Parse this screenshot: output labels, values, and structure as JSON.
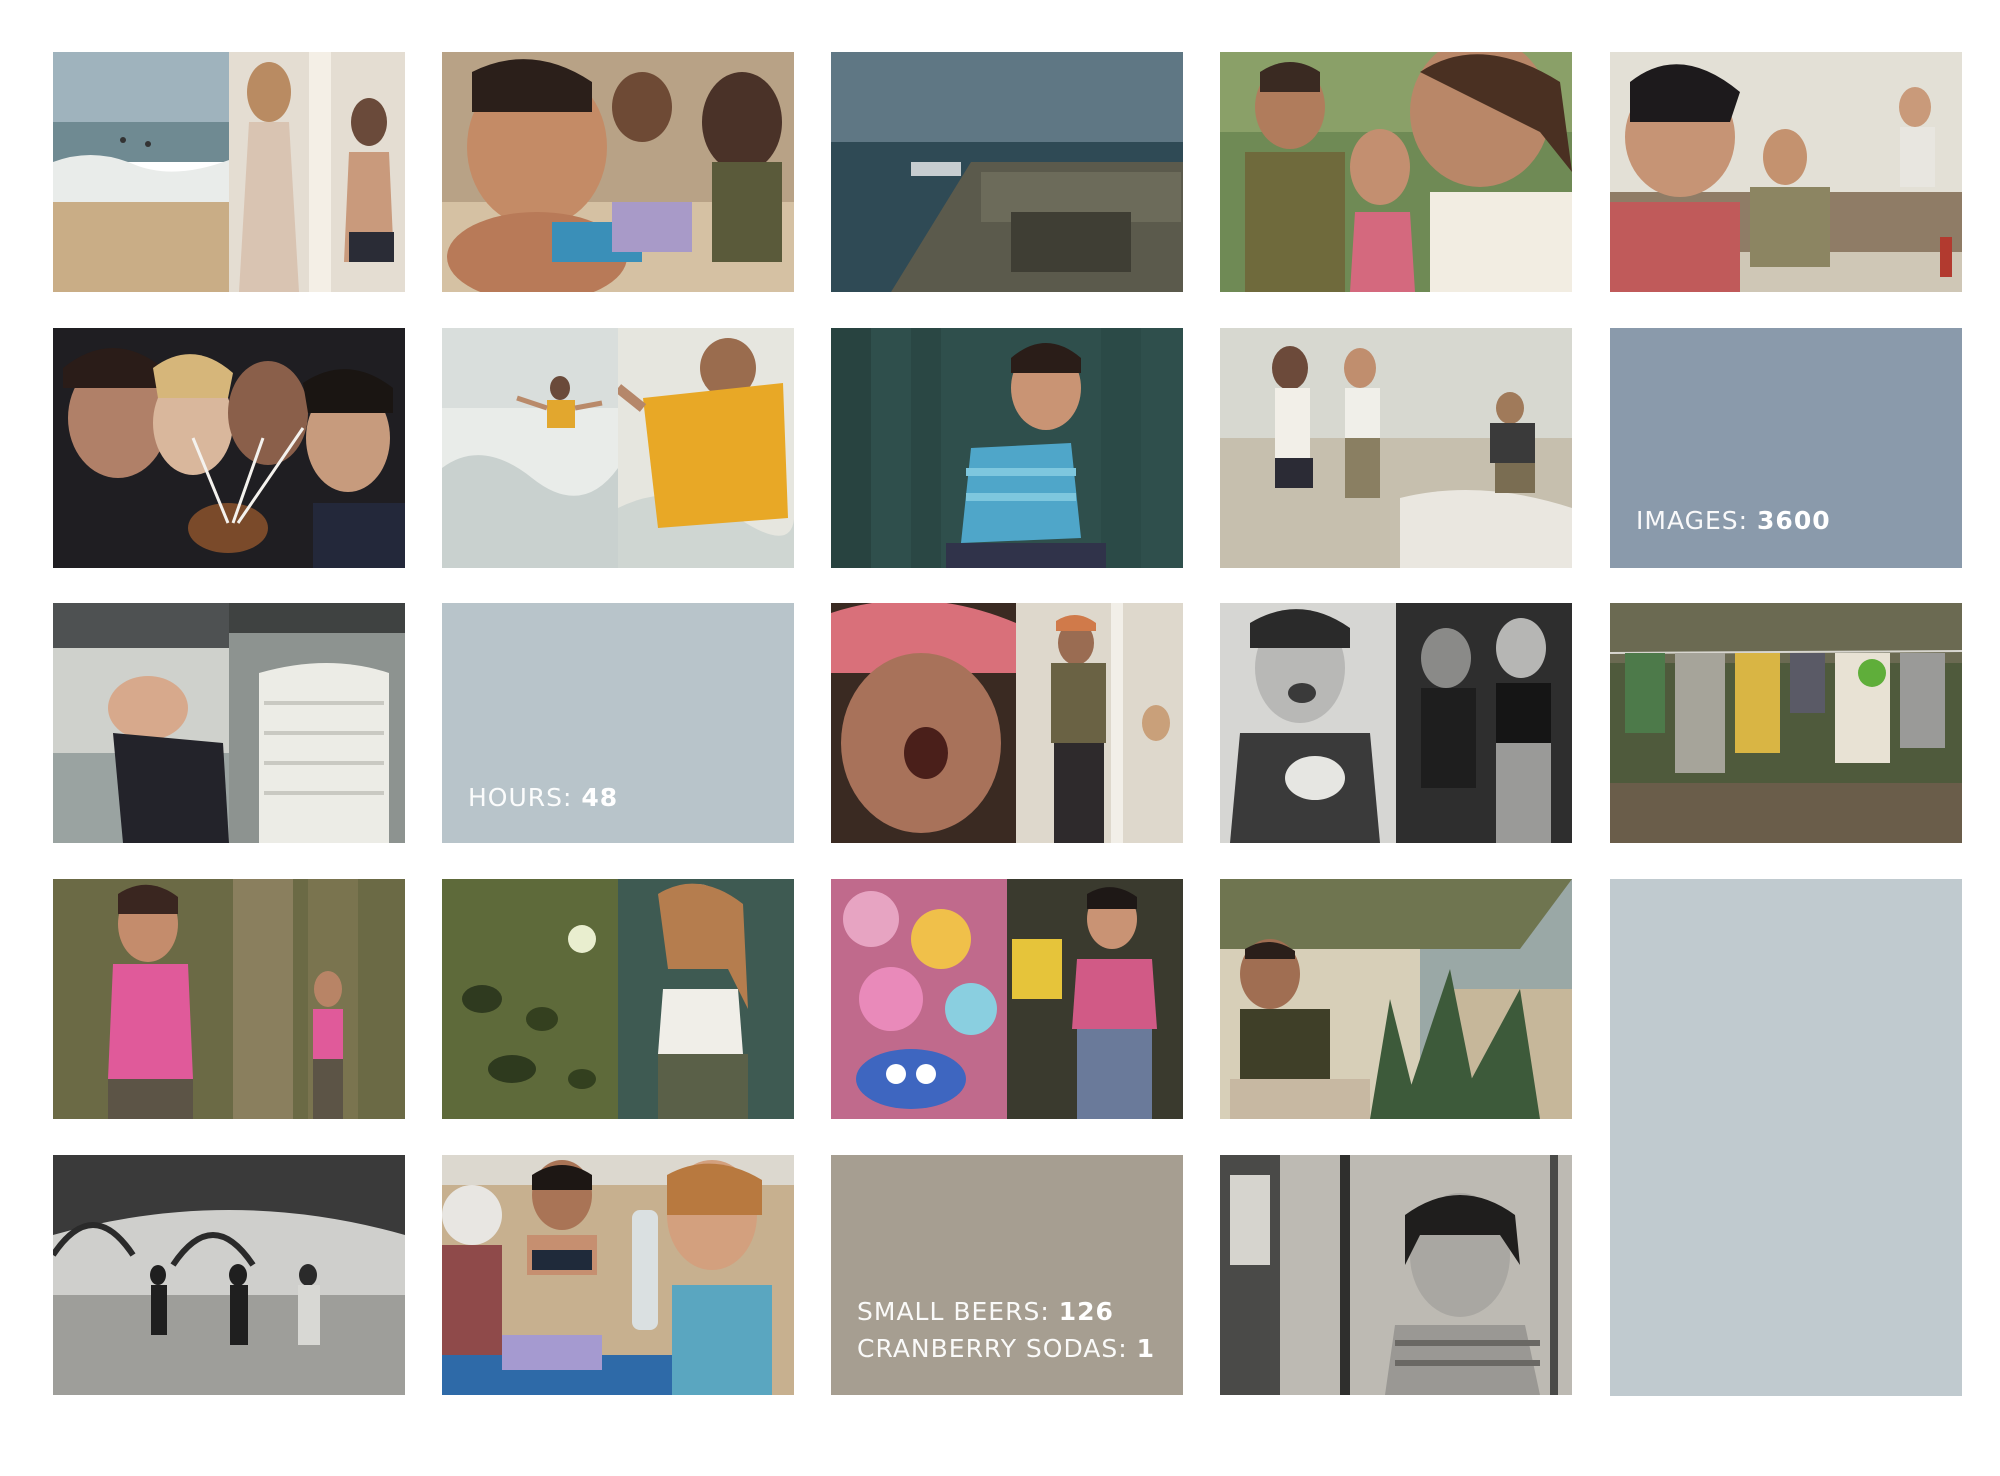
{
  "stats": {
    "images": {
      "label": "IMAGES:",
      "value": "3600"
    },
    "hours": {
      "label": "HOURS:",
      "value": "48"
    },
    "small_beers": {
      "label": "SMALL BEERS:",
      "value": "126"
    },
    "cranberry_sodas": {
      "label": "CRANBERRY SODAS:",
      "value": "1"
    }
  },
  "colors": {
    "panel_slate": "#8a9aab",
    "panel_light_blue": "#b8c4ca",
    "panel_taupe": "#a69e91",
    "panel_pale_blue": "#c0cacf",
    "background": "#ffffff"
  }
}
